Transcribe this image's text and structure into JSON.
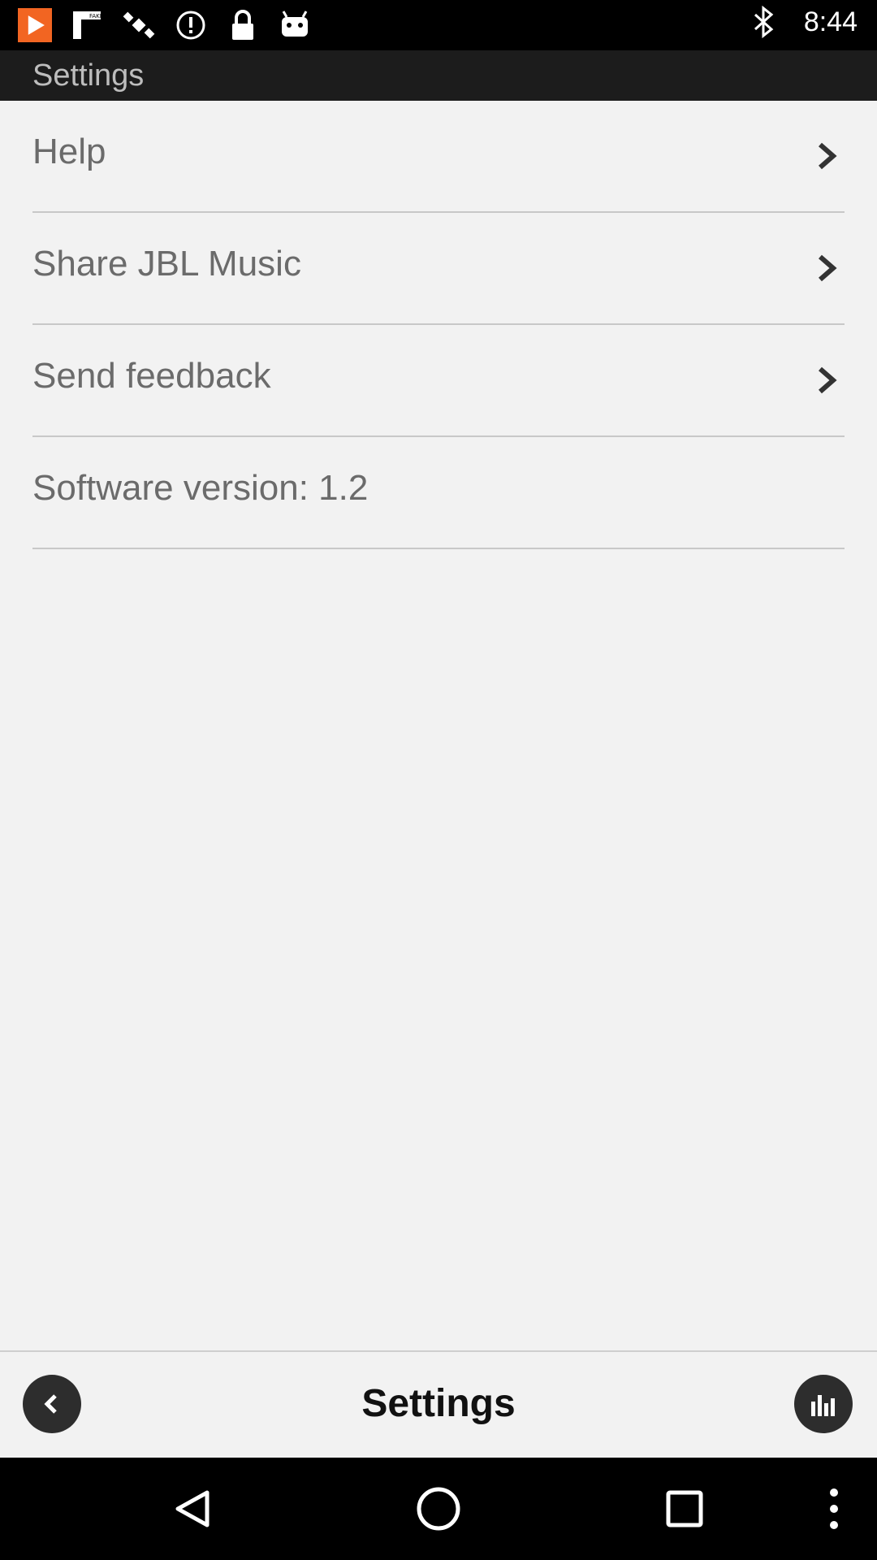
{
  "status_bar": {
    "time": "8:44",
    "left_icons": [
      "play-store-icon",
      "flipboard-icon",
      "satellite-icon",
      "alert-icon",
      "lock-icon",
      "android-icon"
    ],
    "right_icons": [
      "bluetooth-icon"
    ]
  },
  "header": {
    "title": "Settings"
  },
  "settings_list": {
    "items": [
      {
        "label": "Help",
        "has_chevron": true
      },
      {
        "label": "Share JBL Music",
        "has_chevron": true
      },
      {
        "label": "Send feedback",
        "has_chevron": true
      },
      {
        "label": "Software version: 1.2",
        "has_chevron": false
      }
    ]
  },
  "bottom_bar": {
    "title": "Settings",
    "left_icon": "back-icon",
    "right_icon": "equalizer-icon"
  },
  "nav_bar": {
    "icons": [
      "back-triangle-icon",
      "home-circle-icon",
      "recents-square-icon",
      "more-dots-icon"
    ]
  }
}
